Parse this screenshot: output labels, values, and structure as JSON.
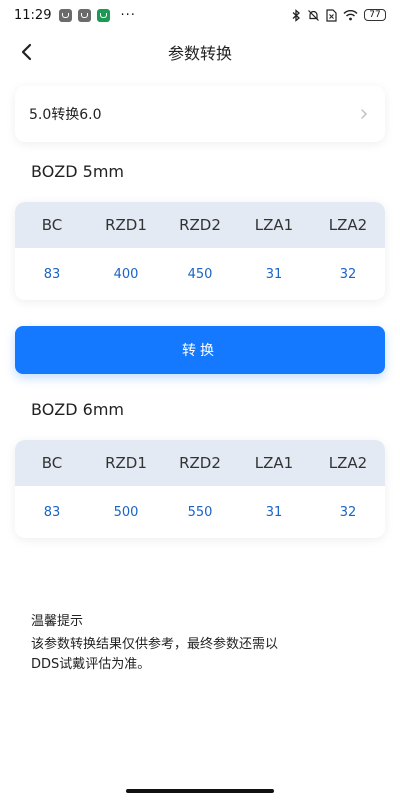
{
  "status_bar": {
    "time": "11:29",
    "dots": "···",
    "battery": "77"
  },
  "header": {
    "title": "参数转换"
  },
  "selector": {
    "label": "5.0转换6.0"
  },
  "table_5mm": {
    "title": "BOZD 5mm",
    "headers": [
      "BC",
      "RZD1",
      "RZD2",
      "LZA1",
      "LZA2"
    ],
    "values": [
      "83",
      "400",
      "450",
      "31",
      "32"
    ]
  },
  "convert_button": {
    "label": "转换"
  },
  "table_6mm": {
    "title": "BOZD 6mm",
    "headers": [
      "BC",
      "RZD1",
      "RZD2",
      "LZA1",
      "LZA2"
    ],
    "values": [
      "83",
      "500",
      "550",
      "31",
      "32"
    ]
  },
  "tips": {
    "title": "温馨提示",
    "line1": "该参数转换结果仅供参考，最终参数还需以",
    "line2": "DDS试戴评估为准。"
  },
  "colors": {
    "accent": "#1479ff",
    "value_text": "#1a64c8",
    "table_header_bg": "#e3eaf4"
  }
}
